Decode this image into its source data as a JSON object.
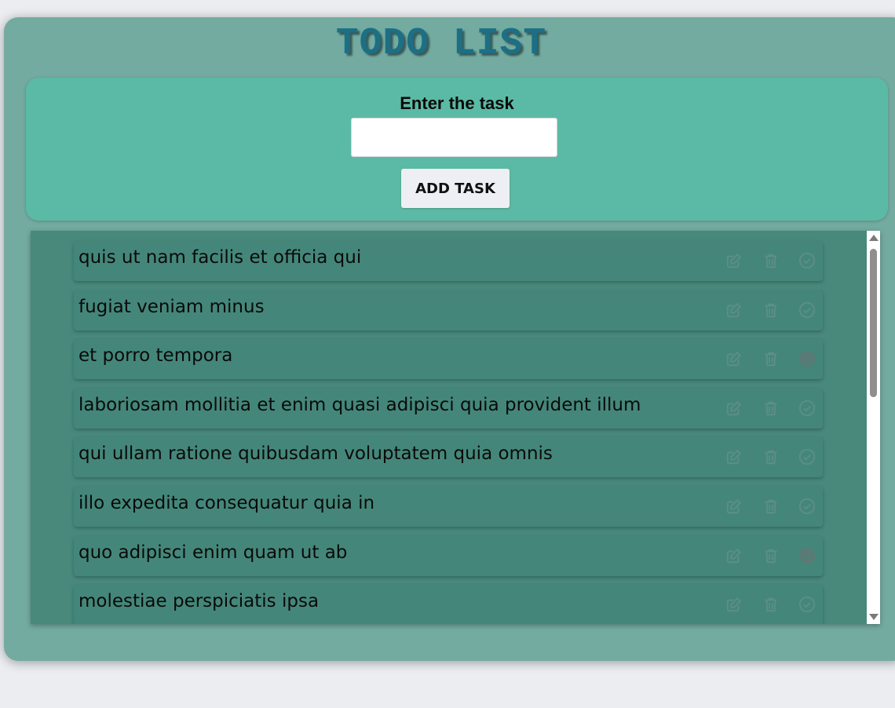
{
  "app": {
    "title": "TODO LIST"
  },
  "form": {
    "label": "Enter the task",
    "input_value": "",
    "input_placeholder": "",
    "add_button_label": "ADD TASK"
  },
  "icons": {
    "edit": "edit-icon",
    "delete": "trash-icon",
    "complete": "check-circle-icon"
  },
  "colors": {
    "app_bg": "#73aba0",
    "form_bg": "#5bbaa5",
    "list_bg": "#48897c",
    "row_bg": "#44877a",
    "title": "#1c6f84",
    "icon": "#5f8f87",
    "done_icon": "#5c7a75"
  },
  "tasks": [
    {
      "text": "quis ut nam facilis et officia qui",
      "completed": false
    },
    {
      "text": "fugiat veniam minus",
      "completed": false
    },
    {
      "text": "et porro tempora",
      "completed": true
    },
    {
      "text": "laboriosam mollitia et enim quasi adipisci quia provident illum",
      "completed": false
    },
    {
      "text": "qui ullam ratione quibusdam voluptatem quia omnis",
      "completed": false
    },
    {
      "text": "illo expedita consequatur quia in",
      "completed": false
    },
    {
      "text": "quo adipisci enim quam ut ab",
      "completed": true
    },
    {
      "text": "molestiae perspiciatis ipsa",
      "completed": false
    }
  ]
}
